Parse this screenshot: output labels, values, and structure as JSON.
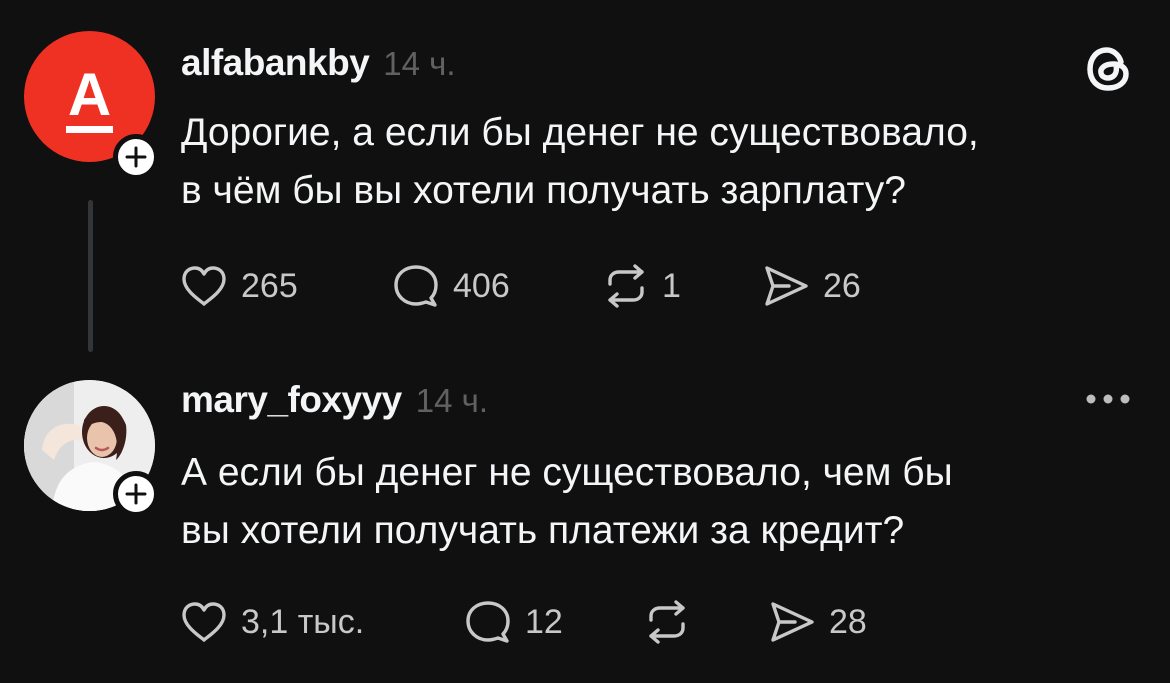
{
  "posts": [
    {
      "username": "alfabankby",
      "time": "14 ч.",
      "avatar_letter": "А",
      "text_lines": [
        "Дорогие, а если бы денег не существовало,",
        "в чём бы вы хотели получать зарплату?"
      ],
      "likes": "265",
      "replies": "406",
      "reposts": "1",
      "shares": "26"
    },
    {
      "username": "mary_foxyyy",
      "time": "14 ч.",
      "text_lines": [
        "А если бы денег не существовало, чем бы",
        "вы хотели получать платежи за кредит?"
      ],
      "likes": "3,1 тыс.",
      "replies": "12",
      "reposts": "",
      "shares": "28"
    }
  ],
  "icons": {
    "brand": "threads-logo-icon",
    "menu": "more-horizontal-icon",
    "like": "heart-icon",
    "reply": "speech-bubble-icon",
    "repost": "repost-icon",
    "share": "send-icon",
    "follow": "plus-icon"
  },
  "colors": {
    "background": "#101010",
    "text": "#f3f5f7",
    "muted": "#616161",
    "alfa_red": "#ef3124",
    "thread_line": "#333638"
  }
}
